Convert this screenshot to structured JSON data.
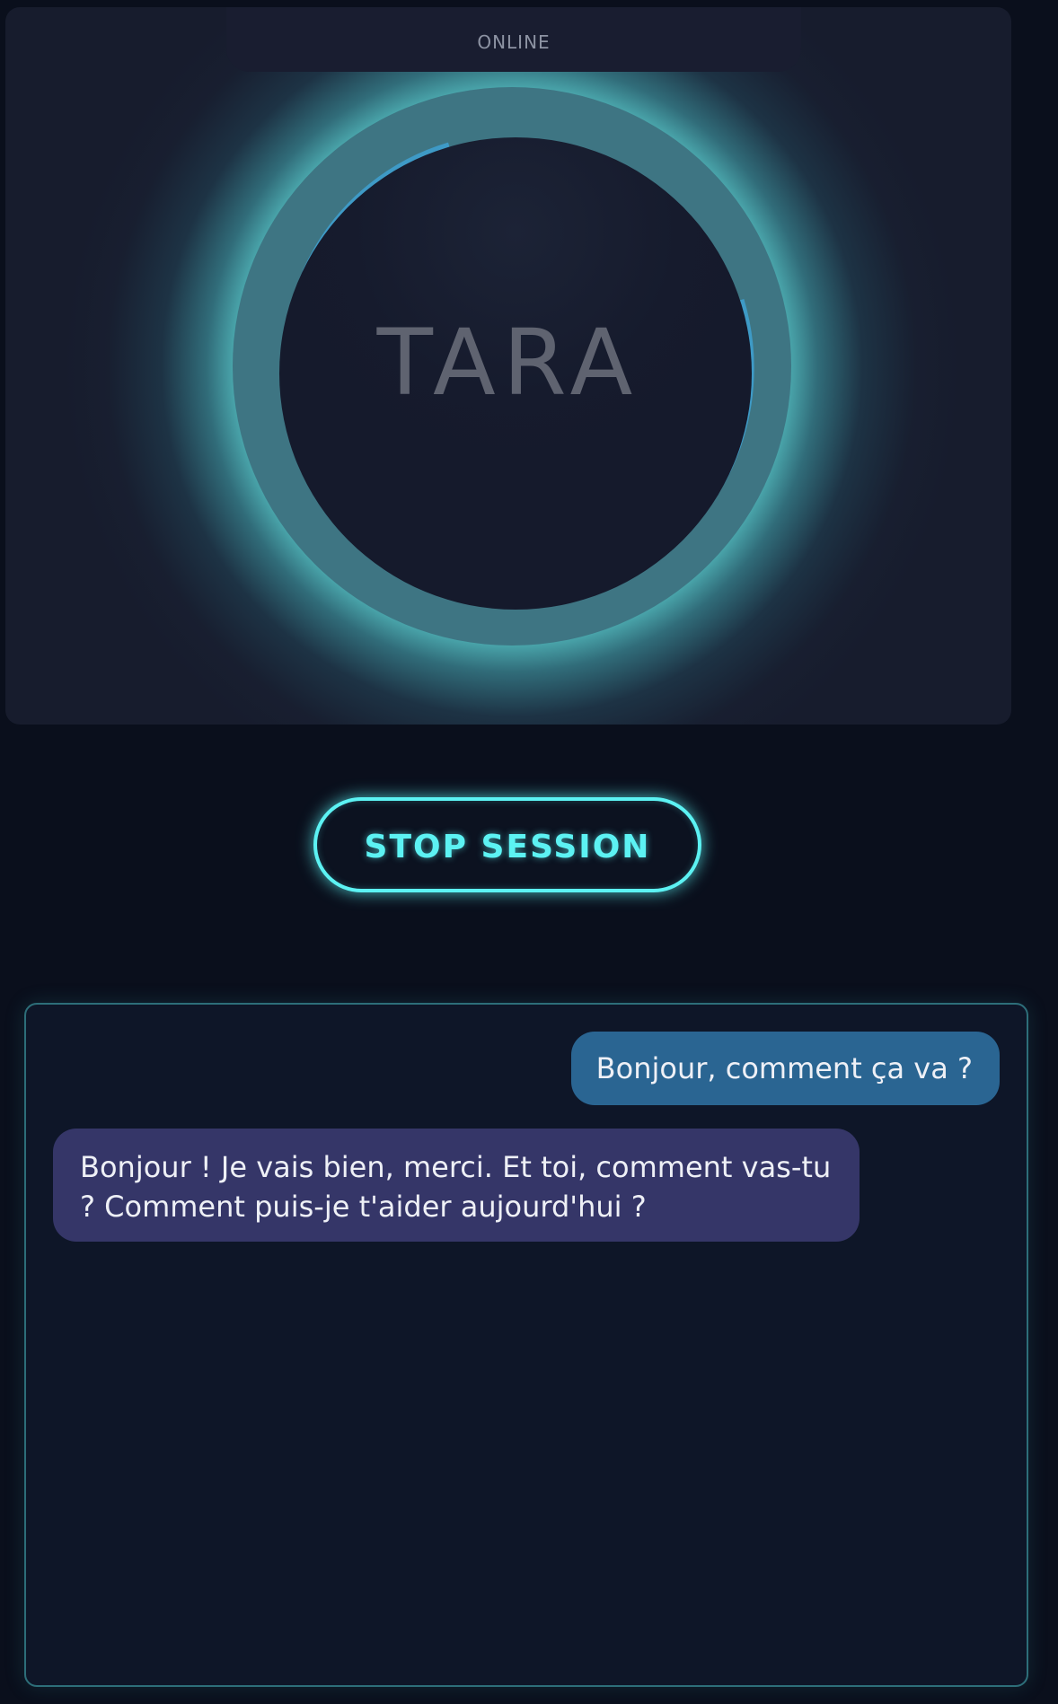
{
  "status": {
    "label": "ONLINE"
  },
  "assistant": {
    "name": "TARA",
    "activity_arcs": 3
  },
  "controls": {
    "stop_label": "STOP SESSION"
  },
  "chat": {
    "messages": [
      {
        "role": "user",
        "text": "Bonjour, comment ça va ?"
      },
      {
        "role": "assistant",
        "text": "Bonjour ! Je vais bien, merci. Et toi, comment vas-tu ? Comment puis-je t'aider aujourd'hui ?"
      }
    ]
  },
  "colors": {
    "background": "#0a0f1c",
    "panel": "#171c2d",
    "glow": "#5cd3d4",
    "accent": "#5cf2f3",
    "progress_arc": "#3e9ac6",
    "user_bubble": "#2a6592",
    "assistant_bubble": "#353668"
  }
}
